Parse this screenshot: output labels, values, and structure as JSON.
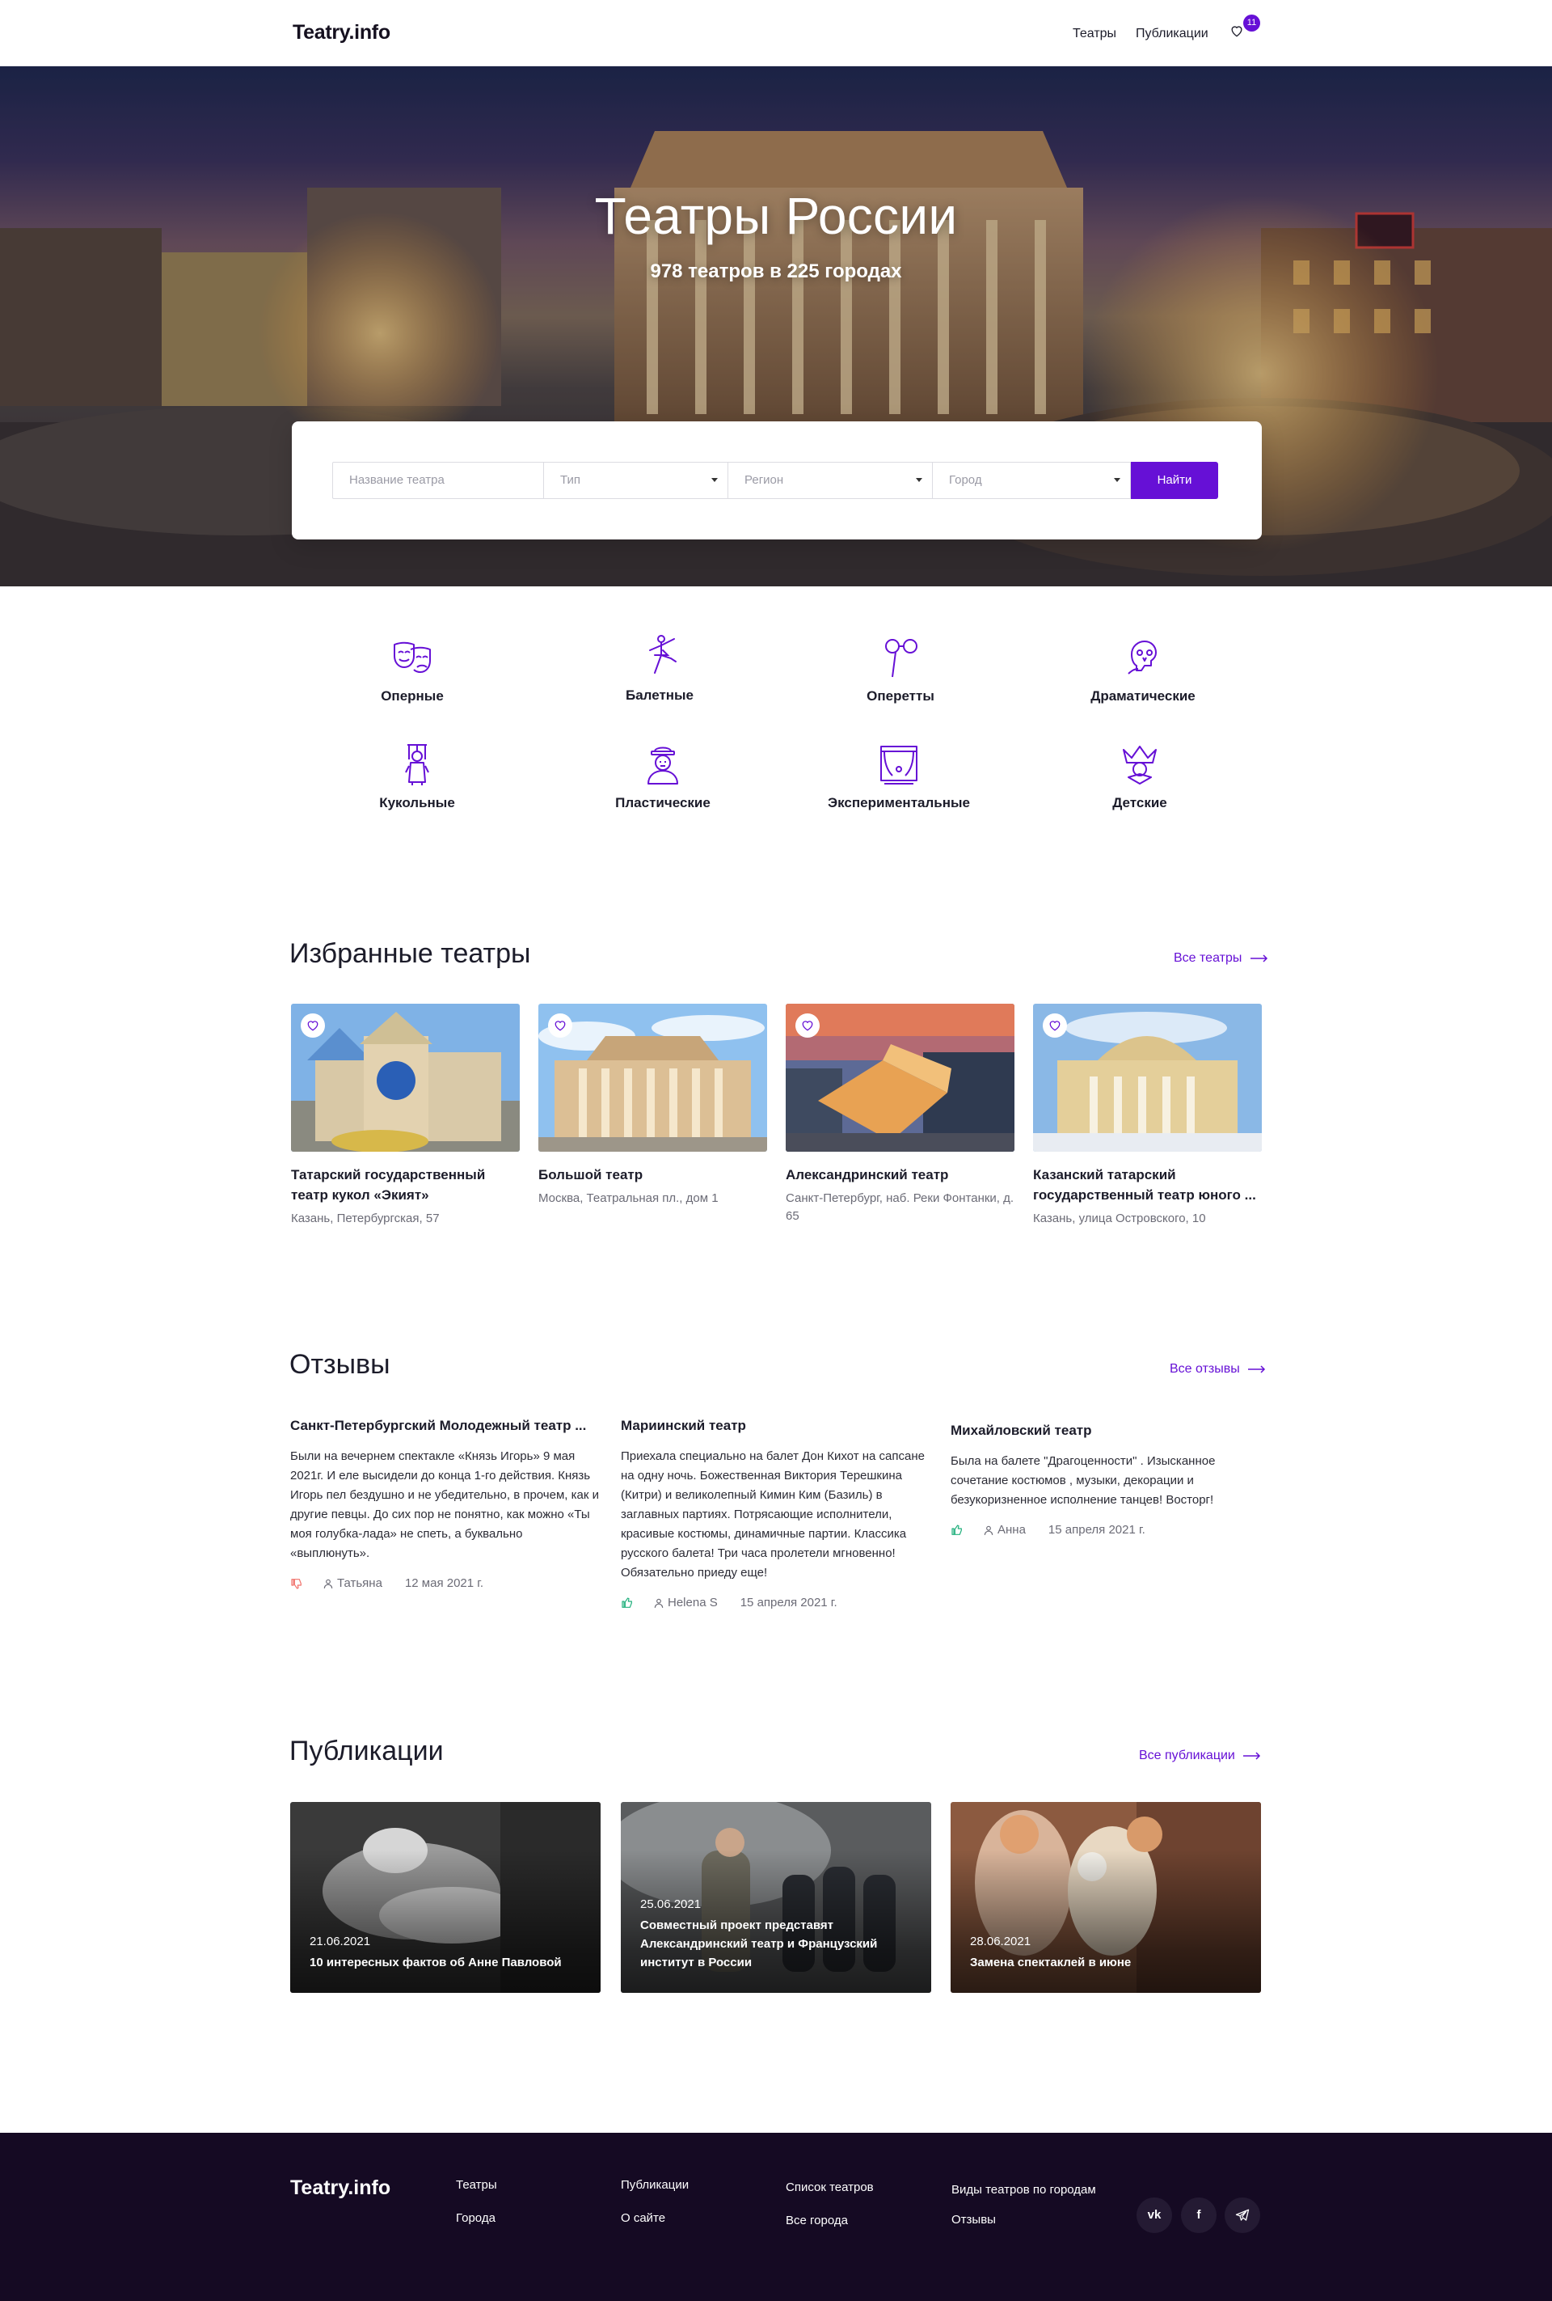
{
  "header": {
    "logo": "Teatry.info",
    "nav": [
      {
        "label": "Театры"
      },
      {
        "label": "Публикации"
      }
    ],
    "favorites_count": "11"
  },
  "hero": {
    "title": "Театры России",
    "subtitle": "978 театров в 225 городах",
    "search": {
      "name_placeholder": "Название театра",
      "type_placeholder": "Тип",
      "region_placeholder": "Регион",
      "city_placeholder": "Город",
      "button_label": "Найти"
    }
  },
  "categories": [
    {
      "label": "Оперные",
      "icon": "masks-icon"
    },
    {
      "label": "Балетные",
      "icon": "ballerina-icon"
    },
    {
      "label": "Оперетты",
      "icon": "opera-glasses-icon"
    },
    {
      "label": "Драматические",
      "icon": "skull-icon"
    },
    {
      "label": "Кукольные",
      "icon": "puppet-icon"
    },
    {
      "label": "Пластические",
      "icon": "mime-icon"
    },
    {
      "label": "Экспериментальные",
      "icon": "stage-icon"
    },
    {
      "label": "Детские",
      "icon": "jester-icon"
    }
  ],
  "featured": {
    "title": "Избранные театры",
    "all_link": "Все театры",
    "items": [
      {
        "name": "Татарский государственный театр кукол «Экият»",
        "address": "Казань, Петербургская, 57"
      },
      {
        "name": "Большой театр",
        "address": "Москва, Театральная пл., дом 1"
      },
      {
        "name": "Александринский театр",
        "address": "Санкт-Петербург, наб. Реки Фонтанки, д. 65"
      },
      {
        "name": "Казанский татарский государственный театр юного ...",
        "address": "Казань, улица Островского, 10"
      }
    ]
  },
  "reviews": {
    "title": "Отзывы",
    "all_link": "Все отзывы",
    "items": [
      {
        "theatre": "Санкт-Петербургский Молодежный театр ...",
        "text": "Были на вечернем спектакле «Князь Игорь» 9 мая 2021г. И еле высидели до конца 1-го действия. Князь Игорь пел бездушно и не убедительно, в прочем, как и другие певцы. До сих пор не понятно, как можно «Ты моя голубка-лада» не спеть, а буквально «выплюнуть».",
        "sentiment": "negative",
        "author": "Татьяна",
        "date": "12 мая 2021 г."
      },
      {
        "theatre": "Мариинский театр",
        "text": "Приехала специально на балет Дон Кихот на сапсане на одну ночь. Божественная Виктория Терешкина (Китри) и великолепный Кимин Ким (Базиль) в заглавных партиях. Потрясающие исполнители, красивые костюмы, динамичные партии. Классика русского балета! Три часа пролетели мгновенно! Обязательно приеду еще!",
        "sentiment": "positive",
        "author": "Helena S",
        "date": "15 апреля 2021 г."
      },
      {
        "theatre": "Михайловский театр",
        "text": "Была на балете \"Драгоценности\" . Изысканное сочетание костюмов , музыки, декорации и безукоризненное исполнение танцев! Восторг!",
        "sentiment": "positive",
        "author": "Анна",
        "date": "15 апреля 2021 г."
      }
    ]
  },
  "publications": {
    "title": "Публикации",
    "all_link": "Все публикации",
    "items": [
      {
        "date": "21.06.2021",
        "title": "10 интересных фактов об Анне Павловой"
      },
      {
        "date": "25.06.2021",
        "title": "Совместный проект представят Александринский театр и Французский институт в России"
      },
      {
        "date": "28.06.2021",
        "title": "Замена спектаклей в июне"
      }
    ]
  },
  "footer": {
    "logo": "Teatry.info",
    "links": {
      "theatres": "Театры",
      "cities": "Города",
      "publications": "Публикации",
      "about": "О сайте",
      "list": "Список театров",
      "all_cities": "Все города",
      "types_by_city": "Виды театров по городам",
      "reviews": "Отзывы"
    },
    "social": {
      "vk": "vk",
      "facebook": "f"
    }
  },
  "colors": {
    "accent": "#6610d6",
    "footer_bg": "#150a23",
    "positive": "#22b07d",
    "negative": "#f0706a"
  }
}
